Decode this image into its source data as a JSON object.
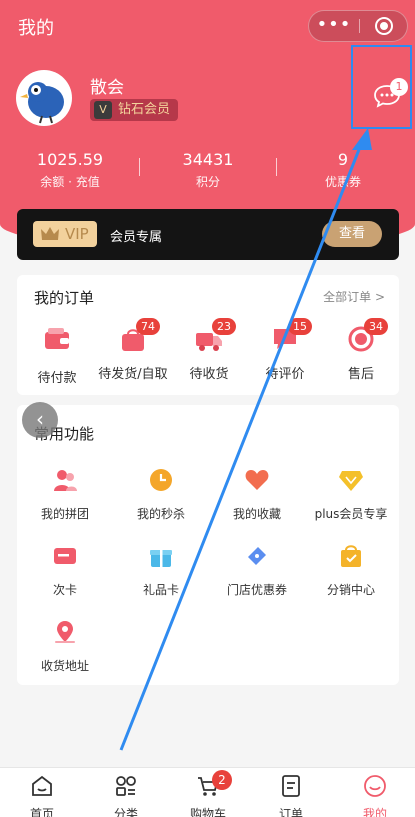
{
  "header": {
    "title": "我的",
    "capsule_more": "•••"
  },
  "profile": {
    "username": "散会",
    "member_level": "钻石会员",
    "message_count": "1"
  },
  "stats": [
    {
      "value": "1025.59",
      "label": "余额 · 充值"
    },
    {
      "value": "34431",
      "label": "积分"
    },
    {
      "value": "9",
      "label": "优惠券"
    }
  ],
  "vip": {
    "tag": "VIP",
    "text": "会员专属",
    "button": "查看"
  },
  "orders": {
    "title": "我的订单",
    "all_link": "全部订单 >",
    "items": [
      {
        "label": "待付款",
        "icon": "wallet-icon",
        "badge": ""
      },
      {
        "label": "待发货/自取",
        "icon": "bag-icon",
        "badge": "74"
      },
      {
        "label": "待收货",
        "icon": "truck-icon",
        "badge": "23"
      },
      {
        "label": "待评价",
        "icon": "comment-icon",
        "badge": "15"
      },
      {
        "label": "售后",
        "icon": "refund-icon",
        "badge": "34"
      }
    ]
  },
  "functions": {
    "title": "常用功能",
    "items": [
      {
        "label": "我的拼团",
        "icon": "group-buy-icon"
      },
      {
        "label": "我的秒杀",
        "icon": "clock-icon"
      },
      {
        "label": "我的收藏",
        "icon": "heart-icon"
      },
      {
        "label": "plus会员专享",
        "icon": "diamond-icon"
      },
      {
        "label": "次卡",
        "icon": "card-icon"
      },
      {
        "label": "礼品卡",
        "icon": "gift-icon"
      },
      {
        "label": "门店优惠券",
        "icon": "coupon-icon"
      },
      {
        "label": "分销中心",
        "icon": "distribution-icon"
      },
      {
        "label": "收货地址",
        "icon": "location-icon"
      }
    ]
  },
  "tabbar": {
    "items": [
      {
        "label": "首页",
        "icon": "home-icon"
      },
      {
        "label": "分类",
        "icon": "category-icon"
      },
      {
        "label": "购物车",
        "icon": "cart-icon",
        "badge": "2"
      },
      {
        "label": "订单",
        "icon": "order-icon"
      },
      {
        "label": "我的",
        "icon": "profile-icon",
        "active": true
      }
    ]
  },
  "colors": {
    "brand": "#f05b6b",
    "badge": "#e8413b",
    "highlight": "#2f8bf0",
    "gold": "#c9a273"
  }
}
